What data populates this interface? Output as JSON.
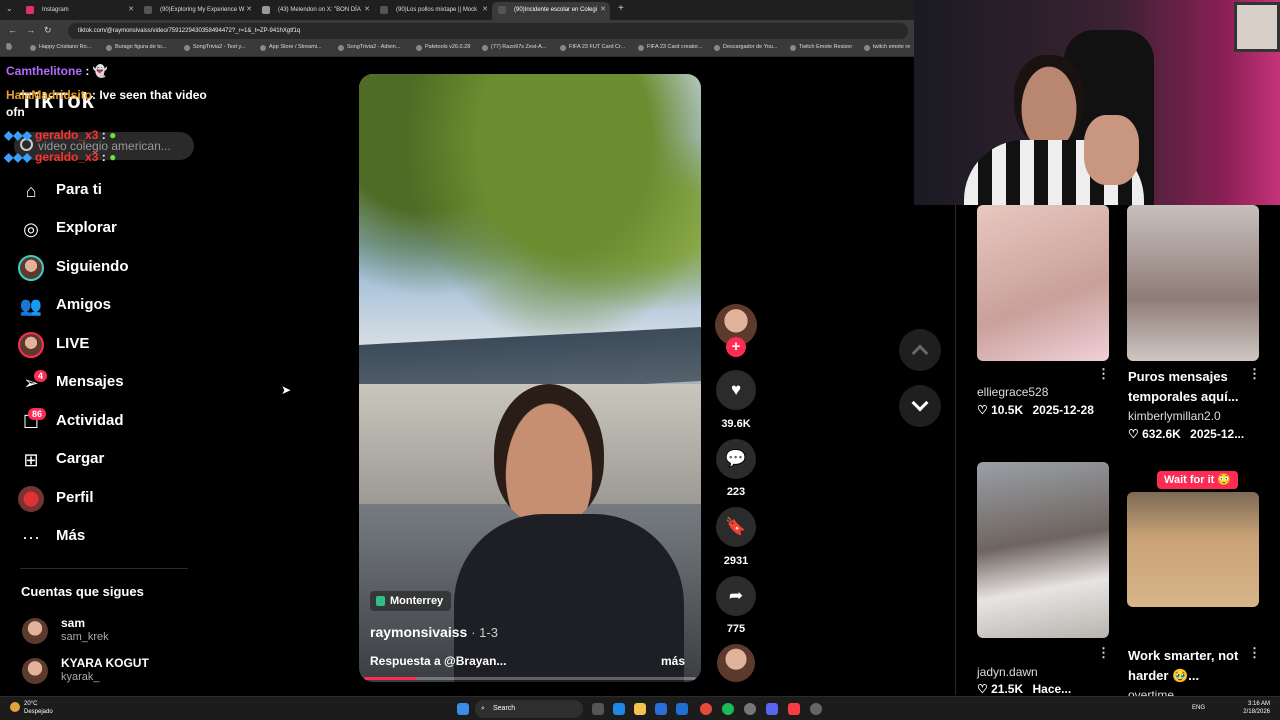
{
  "browser": {
    "tabs": [
      {
        "label": "Instagram",
        "color": "#e1306c",
        "active": false
      },
      {
        "label": "(90)Exploring My Experience W",
        "color": "#222",
        "active": false
      },
      {
        "label": "(43) Melendon on X: \"BON DÍA",
        "color": "#111",
        "active": false
      },
      {
        "label": "(90)Los pollos mixtape || Mock",
        "color": "#222",
        "active": false
      },
      {
        "label": "(90)Incidente escolar en Colegi",
        "color": "#222",
        "active": true
      }
    ],
    "url": "tiktok.com/@raymonsivaiss/video/7591229430358494472?_r=1&_t=ZP-941hXgtf1q",
    "bookmarks": [
      "Happy Cristiano Ro...",
      "Burago figura de to...",
      "SongTrivia2 - Test y...",
      "App Store / Streami...",
      "SongTrivia2 - Adivin...",
      "Paletools v26.0.28",
      "(77) Razo97s Zest-A...",
      "FIFA 23 FUT Card Cr...",
      "FIFA 23 Card creator...",
      "Descargador de You...",
      "Twitch Emote Resizer",
      "twitch emote re"
    ]
  },
  "chat": {
    "line1_user": "Camthelitone",
    "line1_sep": ":",
    "line2_user": "HalaMadridsito",
    "line2_text": ": Ive seen that video ofn",
    "line3_user": "geraldo_x3",
    "line4_user": "geraldo_x3",
    "emote_sep": ":"
  },
  "sidebar": {
    "logo": "TikTok",
    "search_placeholder": "video colegio american...",
    "nav": [
      {
        "label": "Para ti",
        "icon": "home-icon"
      },
      {
        "label": "Explorar",
        "icon": "compass-icon"
      },
      {
        "label": "Siguiendo",
        "icon": "following-avatar-icon"
      },
      {
        "label": "Amigos",
        "icon": "friends-icon"
      },
      {
        "label": "LIVE",
        "icon": "live-avatar-icon"
      },
      {
        "label": "Mensajes",
        "icon": "send-icon",
        "badge": "4"
      },
      {
        "label": "Actividad",
        "icon": "inbox-icon",
        "badge": "86"
      },
      {
        "label": "Cargar",
        "icon": "upload-icon"
      },
      {
        "label": "Perfil",
        "icon": "profile-avatar-icon"
      },
      {
        "label": "Más",
        "icon": "more-icon"
      }
    ],
    "following_title": "Cuentas que sigues",
    "following": [
      {
        "name": "sam",
        "handle": "sam_krek"
      },
      {
        "name": "KYARA KOGUT",
        "handle": "kyarak_"
      }
    ]
  },
  "video": {
    "location": "Monterrey",
    "author": "raymonsivaiss",
    "date": "· 1-3",
    "caption": "Respuesta a @Brayan...",
    "more": "más",
    "progress": 0.16
  },
  "actions": {
    "likes": "39.6K",
    "comments": "223",
    "saves": "2931",
    "shares": "775"
  },
  "recommended": [
    {
      "title": "",
      "user": "elliegrace528",
      "likes": "10.5K",
      "date": "2025-12-28",
      "thumb": "#d8b0b0"
    },
    {
      "title": "Puros mensajes temporales aquí...",
      "user": "kimberlymillan2.0",
      "likes": "632.6K",
      "date": "2025-12...",
      "thumb": "#b9a8a5"
    },
    {
      "title": "",
      "user": "jadyn.dawn",
      "likes": "21.5K",
      "date": "Hace...",
      "thumb": "#8d8f94"
    },
    {
      "title": "Work smarter, not harder 🥹...",
      "user": "overtime",
      "likes": "",
      "date": "",
      "thumb": "#c7a27a"
    }
  ],
  "wait_badge": "Wait for it 😳",
  "taskbar": {
    "weather_temp": "20°C",
    "weather_desc": "Despejado",
    "search": "Search",
    "lang": "ENG",
    "time": "3:16 AM",
    "date": "2/18/2026"
  }
}
